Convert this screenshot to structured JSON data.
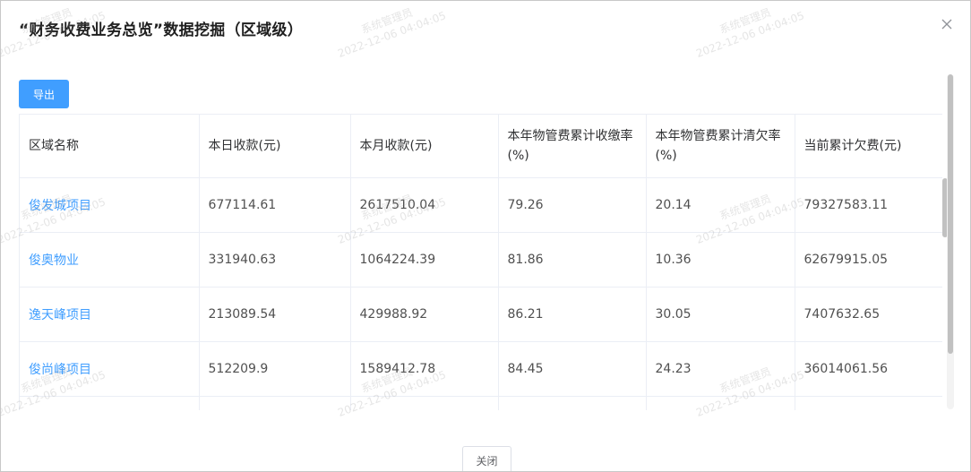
{
  "dialog": {
    "title": "“财务收费业务总览”数据挖掘（区域级）",
    "export_label": "导出",
    "close_label": "关闭"
  },
  "table": {
    "headers": [
      "区域名称",
      "本日收款(元)",
      "本月收款(元)",
      "本年物管费累计收缴率(%)",
      "本年物管费累计清欠率(%)",
      "当前累计欠费(元)"
    ],
    "rows": [
      [
        "俊发城项目",
        "677114.61",
        "2617510.04",
        "79.26",
        "20.14",
        "79327583.11"
      ],
      [
        "俊奥物业",
        "331940.63",
        "1064224.39",
        "81.86",
        "10.36",
        "62679915.05"
      ],
      [
        "逸天峰项目",
        "213089.54",
        "429988.92",
        "86.21",
        "30.05",
        "7407632.65"
      ],
      [
        "俊尚峰项目",
        "512209.9",
        "1589412.78",
        "84.45",
        "24.23",
        "36014061.56"
      ]
    ]
  },
  "watermark": {
    "user": "系统管理员",
    "time": "2022-12-06 04:04:05"
  },
  "colors": {
    "accent": "#409eff",
    "link": "#409eff",
    "border": "#ebeef5"
  }
}
